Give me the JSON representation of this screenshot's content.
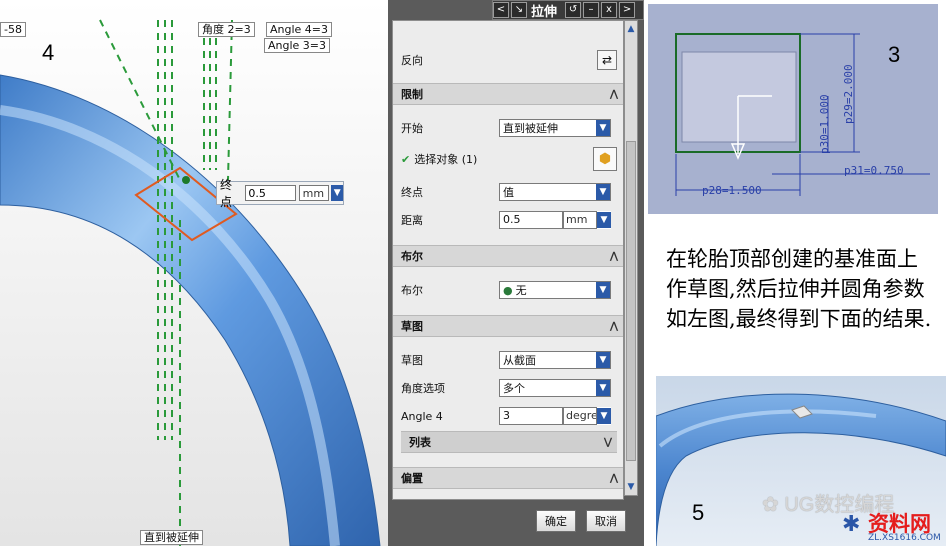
{
  "viewport": {
    "labels": {
      "left_edge_value": "-58",
      "angle_2": "角度 2=3",
      "angle_4": "Angle 4=3",
      "angle_3": "Angle 3=3",
      "bottom_label": "直到被延伸",
      "view_number": "4"
    },
    "end_popup": {
      "label": "终点",
      "value": "0.5",
      "unit": "mm"
    },
    "colors": {
      "tube": "#4a86d0",
      "handle": "#e05a20",
      "guide": "#2a9a3a"
    }
  },
  "dialog": {
    "title": "拉伸",
    "title_buttons": [
      "<",
      "↘",
      "x",
      ">"
    ],
    "reverse_label": "反向",
    "sections": {
      "limits": "限制",
      "boolean": "布尔",
      "draft": "草图",
      "offset": "偏置"
    },
    "limits": {
      "start_label": "开始",
      "start_value": "直到被延伸",
      "select_object": "选择对象 (1)",
      "end_label": "终点",
      "end_value": "值",
      "distance_label": "距离",
      "distance_value": "0.5",
      "distance_unit": "mm"
    },
    "boolean": {
      "label": "布尔",
      "value": "无"
    },
    "draft": {
      "draft_label": "草图",
      "draft_value": "从截面",
      "angle_option_label": "角度选项",
      "angle_option_value": "多个",
      "angle4_label": "Angle 4",
      "angle4_value": "3",
      "angle4_unit": "degree",
      "list_label": "列表"
    },
    "ok_label": "确定",
    "cancel_label": "取消"
  },
  "sketch_panel": {
    "number": "3",
    "dims": {
      "p29": "p29=2.000",
      "p30": "p30=1.000",
      "p31": "p31=0.750",
      "p28": "p28=1.500"
    }
  },
  "description": "在轮胎顶部创建的基准面上作草图,然后拉伸并圆角参数如左图,最终得到下面的结果.",
  "result_panel": {
    "number": "5"
  },
  "watermark": {
    "text": "UG数控编程",
    "logo_main": "资料网",
    "logo_url": "ZL.XS1616.COM"
  }
}
